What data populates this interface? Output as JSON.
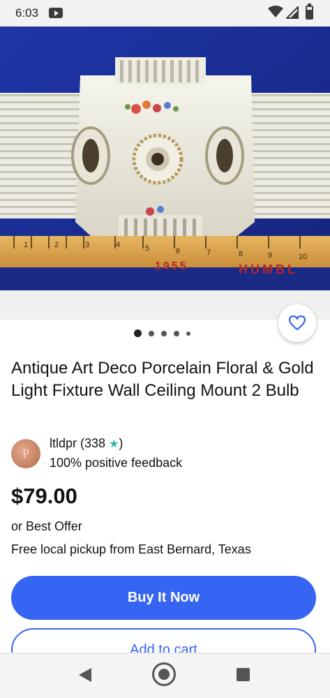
{
  "status_bar": {
    "time": "6:03"
  },
  "listing": {
    "title": "Antique Art Deco Porcelain Floral & Gold Light Fixture Wall Ceiling Mount 2 Bulb",
    "image_count": 5,
    "active_image": 1,
    "ruler_marks": [
      "1",
      "2",
      "3",
      "4",
      "5",
      "6",
      "7",
      "8",
      "9",
      "10"
    ],
    "ruler_text_year": "1955",
    "ruler_text_brand": "HUMBL",
    "price": "$79.00",
    "best_offer": "or Best Offer",
    "pickup": "Free local pickup from East Bernard, Texas"
  },
  "seller": {
    "name_prefix": "ltldpr (338",
    "name_suffix": ")",
    "feedback": "100% positive feedback",
    "avatar_letter": "P"
  },
  "actions": {
    "buy_now": "Buy It Now",
    "add_to_cart": "Add to cart"
  },
  "colors": {
    "accent": "#3665f3",
    "star": "#2bb7a9",
    "image_background": "#1c2f8f"
  }
}
